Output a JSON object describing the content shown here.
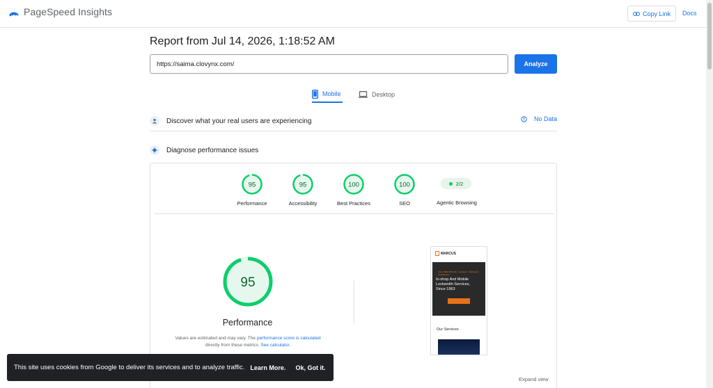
{
  "header": {
    "app_name": "PageSpeed Insights",
    "copy_link_label": "Copy Link",
    "docs_label": "Docs"
  },
  "report": {
    "title": "Report from Jul 14, 2026, 1:18:52 AM",
    "url_value": "https://saima.clovynx.com/",
    "analyze_label": "Analyze"
  },
  "tabs": [
    {
      "label": "Mobile",
      "icon": "mobile-phone-icon",
      "selected": true
    },
    {
      "label": "Desktop",
      "icon": "laptop-icon",
      "selected": false
    }
  ],
  "field_data": {
    "title": "Discover what your real users are experiencing",
    "status": "No Data",
    "icon": "users-icon"
  },
  "diagnose": {
    "title": "Diagnose performance issues",
    "icon": "diagnose-icon"
  },
  "categories": [
    {
      "label": "Performance",
      "score": "95",
      "fraction": 0.95,
      "color": "#0cce6b"
    },
    {
      "label": "Accessibility",
      "score": "95",
      "fraction": 0.95,
      "color": "#0cce6b"
    },
    {
      "label": "Best Practices",
      "score": "100",
      "fraction": 1.0,
      "color": "#0cce6b"
    },
    {
      "label": "SEO",
      "score": "100",
      "fraction": 1.0,
      "color": "#0cce6b"
    }
  ],
  "agentic": {
    "label": "Agentic Browsing",
    "value": "2/2"
  },
  "performance": {
    "score": "95",
    "fraction": 0.95,
    "title": "Performance",
    "note_prefix": "Values are estimated and may vary. The",
    "note_link1": "performance score is calculated",
    "note_middle": "directly from these metrics.",
    "note_link2": "See calculator."
  },
  "preview": {
    "logo_text": "MARCUS",
    "hero_sub": "CALL 0800 000 000 · Auckland · Wellington · Christchurch",
    "hero_text": "In-shop And Mobile Locksmith Services, Since 1963",
    "services_label": "Our Services",
    "expand_label": "Expand view"
  },
  "cookie": {
    "text": "This site uses cookies from Google to deliver its services and to analyze traffic.",
    "learn_more": "Learn More.",
    "ok": "Ok, Got it."
  },
  "colors": {
    "accent": "#1a73e8",
    "good": "#0cce6b"
  }
}
